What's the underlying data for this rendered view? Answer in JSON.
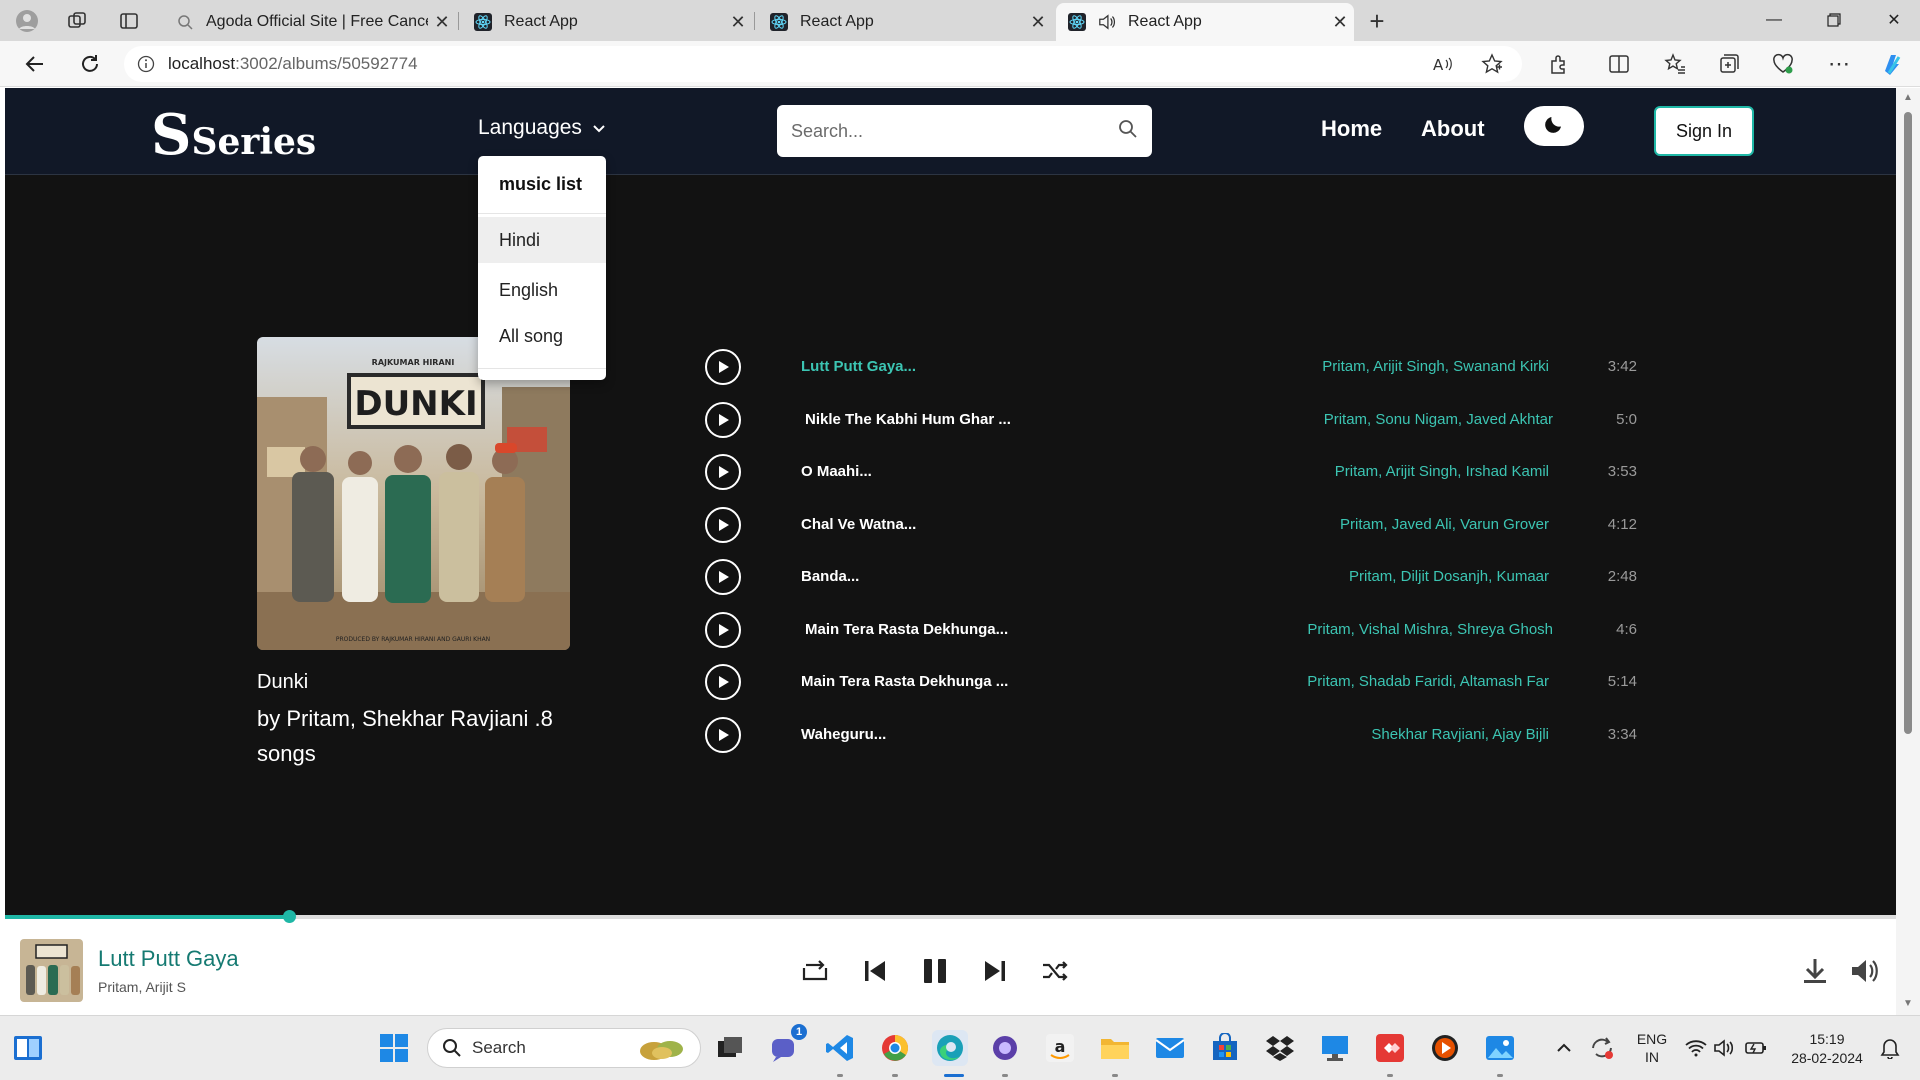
{
  "browser": {
    "tabs": [
      {
        "title": "Agoda Official Site | Free Cancellation",
        "active": false
      },
      {
        "title": "React App",
        "active": false
      },
      {
        "title": "React App",
        "active": false
      },
      {
        "title": "React App",
        "active": true
      }
    ],
    "url_host": "localhost",
    "url_path": ":3002/albums/50592774"
  },
  "navbar": {
    "logo_big": "S",
    "logo_rest": "Series",
    "languages_label": "Languages",
    "search_placeholder": "Search...",
    "home_label": "Home",
    "about_label": "About",
    "signin_label": "Sign In"
  },
  "dropdown": {
    "header": "music list",
    "items": [
      "Hindi",
      "English",
      "All song"
    ]
  },
  "album": {
    "name": "Dunki",
    "by_line": "by Pritam, Shekhar Ravjiani .8 songs"
  },
  "tracks": [
    {
      "title": "Lutt Putt Gaya...",
      "artists": "Pritam, Arijit Singh, Swanand Kirki",
      "duration": "3:42"
    },
    {
      "title": "Nikle The Kabhi Hum Ghar ...",
      "artists": "Pritam, Sonu Nigam, Javed Akhtar",
      "duration": "5:0"
    },
    {
      "title": "O Maahi...",
      "artists": "Pritam, Arijit Singh, Irshad Kamil",
      "duration": "3:53"
    },
    {
      "title": "Chal Ve Watna...",
      "artists": "Pritam, Javed Ali, Varun Grover",
      "duration": "4:12"
    },
    {
      "title": "Banda...",
      "artists": "Pritam, Diljit Dosanjh, Kumaar",
      "duration": "2:48"
    },
    {
      "title": "Main Tera Rasta Dekhunga...",
      "artists": "Pritam, Vishal Mishra, Shreya Ghosh",
      "duration": "4:6"
    },
    {
      "title": "Main Tera Rasta Dekhunga ...",
      "artists": "Pritam, Shadab Faridi, Altamash Far",
      "duration": "5:14"
    },
    {
      "title": "Waheguru...",
      "artists": "Shekhar Ravjiani, Ajay Bijli",
      "duration": "3:34"
    }
  ],
  "player": {
    "title": "Lutt Putt Gaya",
    "artist": "Pritam, Arijit S",
    "progress": 0.15
  },
  "taskbar": {
    "search_label": "Search",
    "language_line1": "ENG",
    "language_line2": "IN",
    "time": "15:19",
    "date": "28-02-2024",
    "teams_badge": "1"
  },
  "colors": {
    "accent": "#1fb7a6",
    "artist_text": "#3cc5b3",
    "page_bg": "#121212",
    "navbar_bg": "#111827"
  }
}
